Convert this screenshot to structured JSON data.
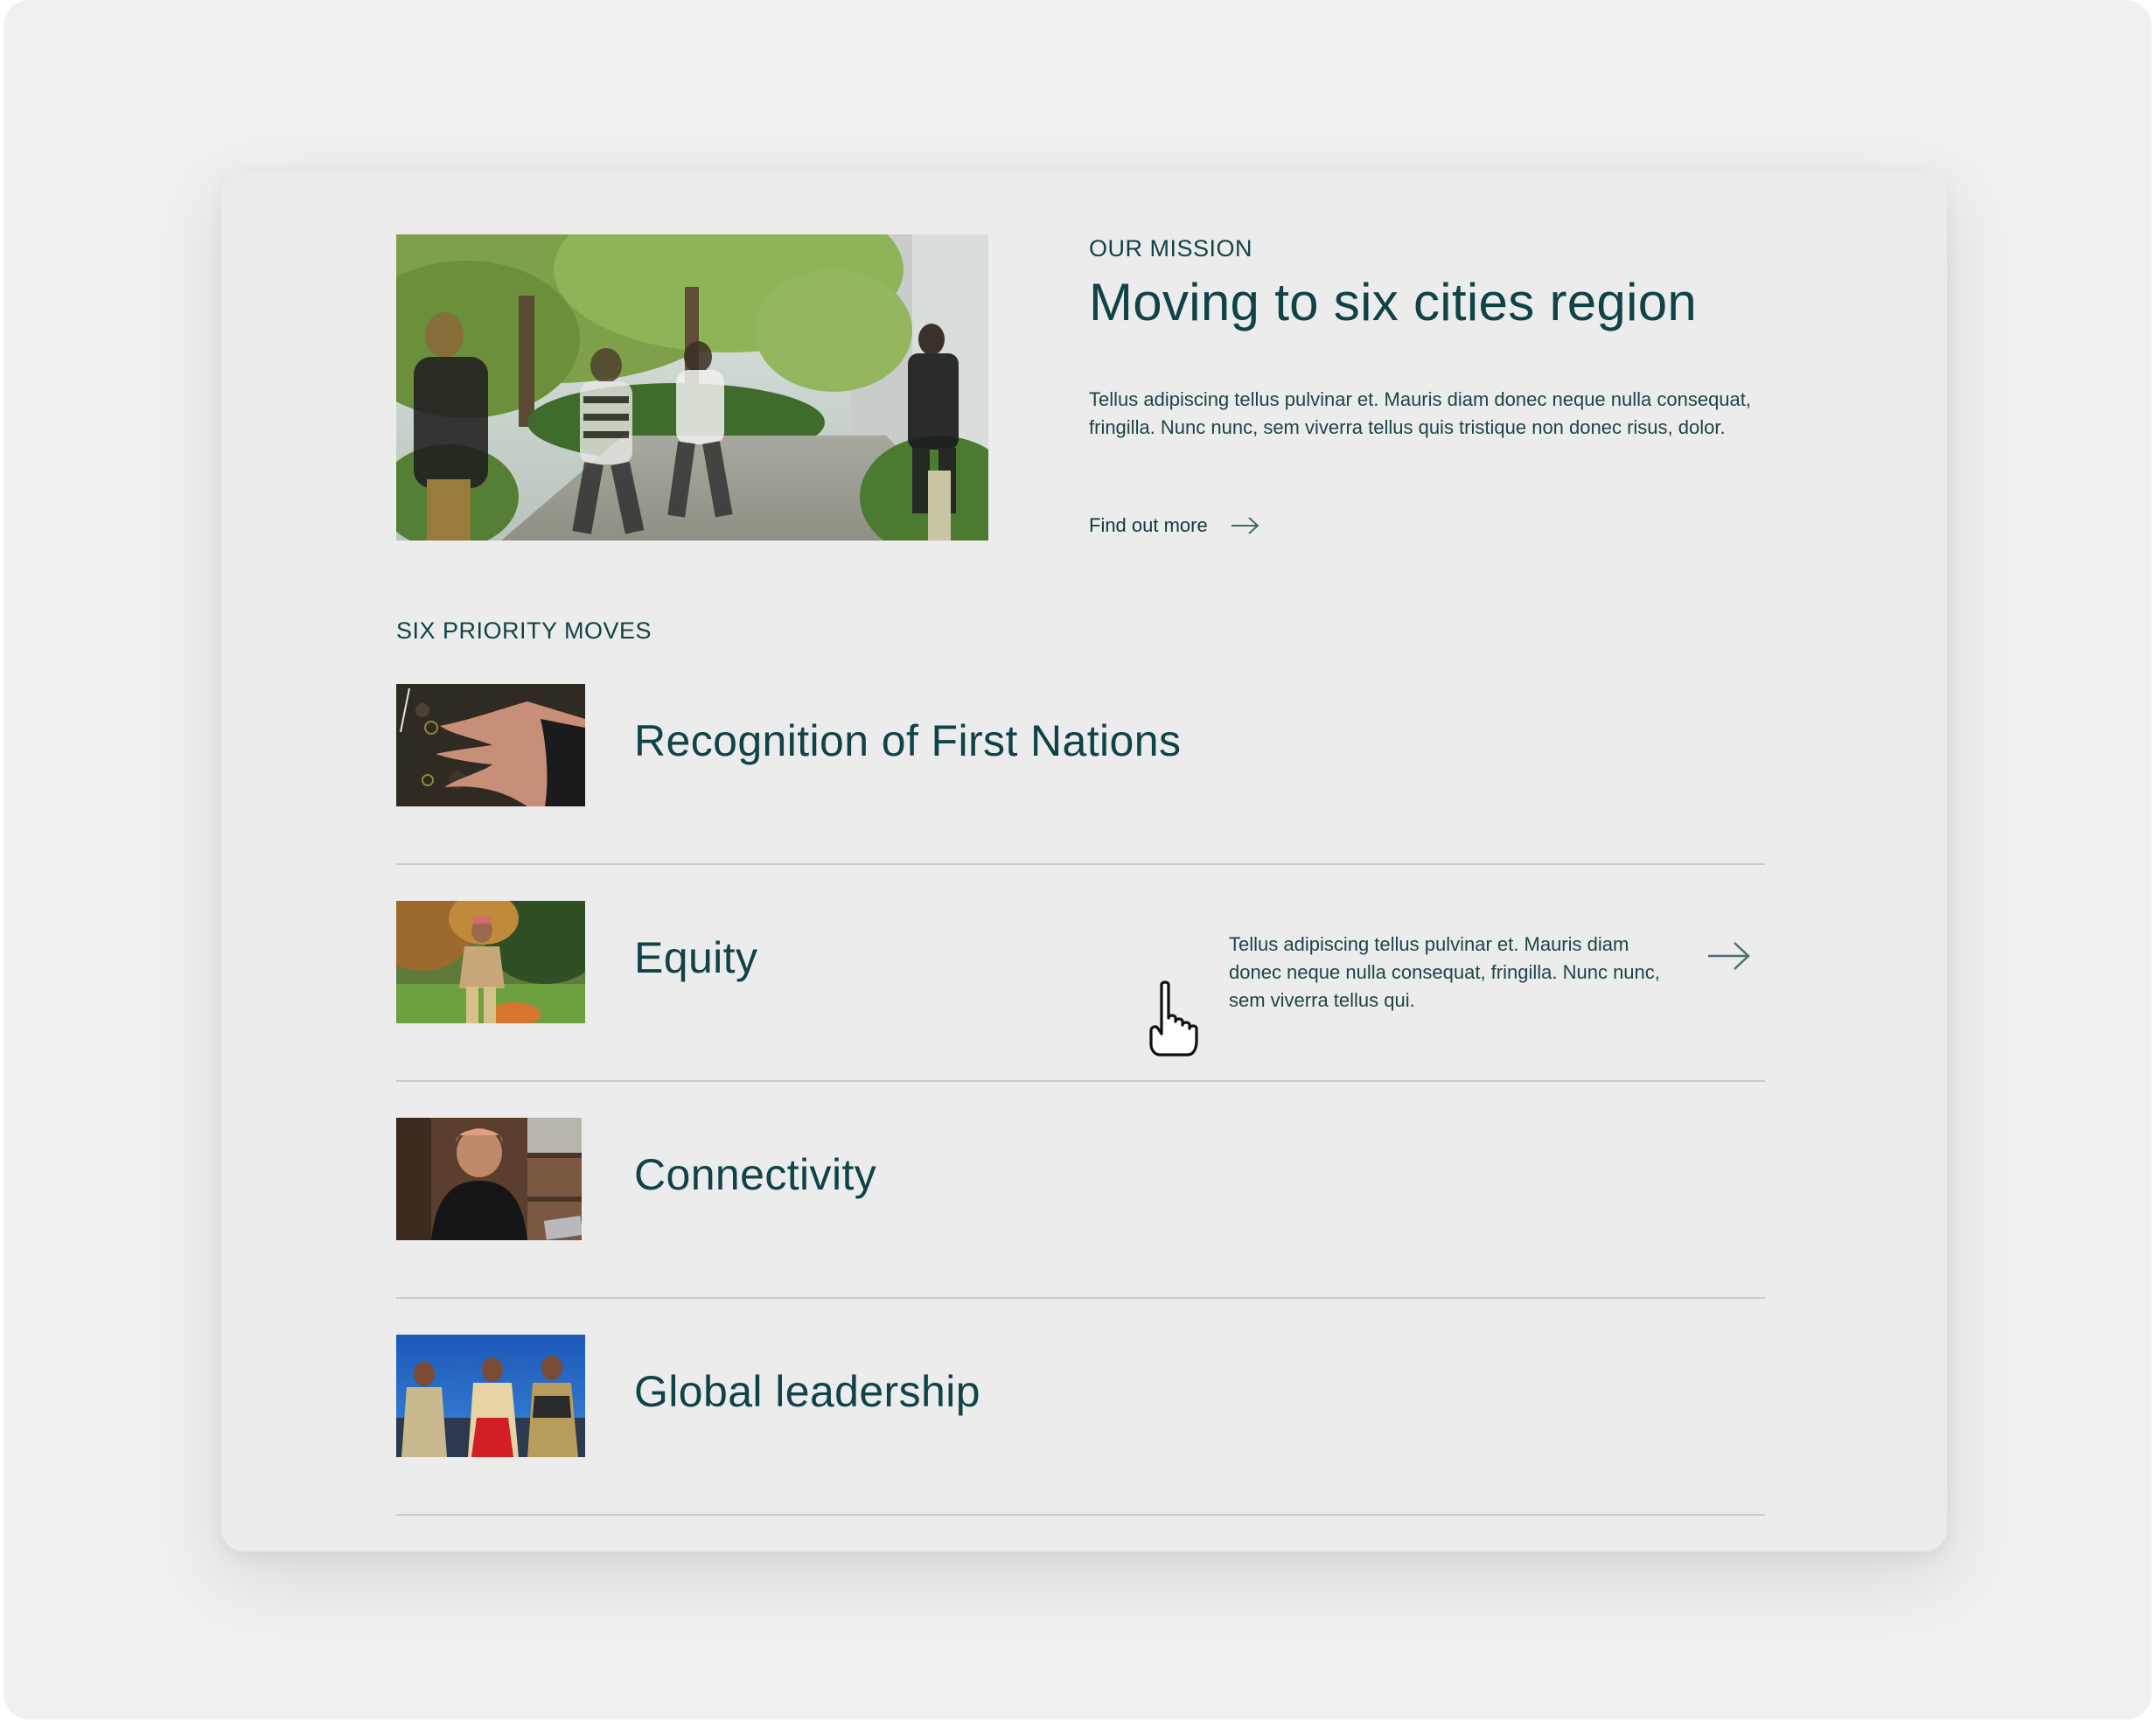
{
  "mission": {
    "eyebrow": "OUR MISSION",
    "title": "Moving to six cities region",
    "body": "Tellus adipiscing tellus pulvinar et. Mauris diam donec neque nulla consequat, fringilla. Nunc nunc, sem viverra tellus quis tristique non donec risus, dolor.",
    "link_label": "Find out more"
  },
  "moves": {
    "eyebrow": "SIX PRIORITY MOVES",
    "items": [
      {
        "title": "Recognition of First Nations"
      },
      {
        "title": "Equity",
        "description": "Tellus adipiscing tellus pulvinar et. Mauris diam donec neque nulla consequat, fringilla. Nunc nunc, sem viverra tellus qui."
      },
      {
        "title": "Connectivity"
      },
      {
        "title": "Global leadership"
      }
    ]
  },
  "icons": {
    "link_arrow": "arrow-right-icon",
    "row_arrow": "arrow-right-icon",
    "cursor": "hand-pointer-icon"
  },
  "colors": {
    "text_primary": "#0f4348",
    "card_background": "#ececec",
    "page_background": "#f0f0f0",
    "divider": "#c9cccb"
  }
}
